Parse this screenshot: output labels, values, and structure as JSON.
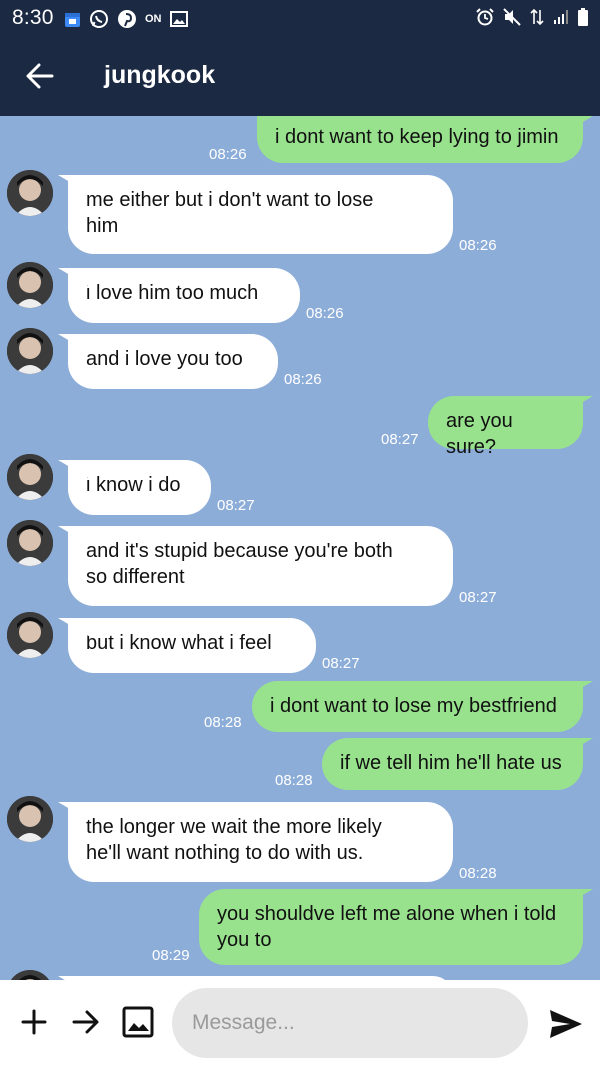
{
  "status_bar": {
    "time": "8:30",
    "icons_left": [
      "calendar-icon",
      "whatsapp-icon",
      "pinterest-icon",
      "on-icon",
      "image-icon"
    ],
    "icons_right": [
      "alarm-icon",
      "mute-icon",
      "data-icon",
      "signal-icon",
      "battery-icon"
    ],
    "on_label": "ON"
  },
  "header": {
    "title": "jungkook",
    "back_icon": "back-arrow-icon"
  },
  "messages": [
    {
      "dir": "out",
      "lines": [
        "i dont want to keep lying to jimin"
      ],
      "time": "08:26"
    },
    {
      "dir": "in",
      "lines": [
        "me either but i don't want to lose",
        "him"
      ],
      "time": "08:26"
    },
    {
      "dir": "in",
      "lines": [
        "i love him too much"
      ],
      "time": "08:26"
    },
    {
      "dir": "in",
      "lines": [
        "and i love you too"
      ],
      "time": "08:26"
    },
    {
      "dir": "out",
      "lines": [
        "are you sure?"
      ],
      "time": "08:27"
    },
    {
      "dir": "in",
      "lines": [
        "i know i do"
      ],
      "time": "08:27"
    },
    {
      "dir": "in",
      "lines": [
        "and it's stupid because you're both",
        "so different"
      ],
      "time": "08:27"
    },
    {
      "dir": "in",
      "lines": [
        "but i know what i feel"
      ],
      "time": "08:27"
    },
    {
      "dir": "out",
      "lines": [
        "i dont want to lose my bestfriend"
      ],
      "time": "08:28"
    },
    {
      "dir": "out",
      "lines": [
        "if we tell him he'll hate us"
      ],
      "time": "08:28"
    },
    {
      "dir": "in",
      "lines": [
        "the longer we wait the more likely",
        "he'll want nothing to do with us."
      ],
      "time": "08:28"
    },
    {
      "dir": "out",
      "lines": [
        "you shouldve left me alone when i told",
        "you to"
      ],
      "time": "08:29"
    }
  ],
  "input_bar": {
    "placeholder": "Message...",
    "value": "",
    "icons": [
      "plus-icon",
      "forward-arrow-icon",
      "image-icon",
      "send-icon"
    ]
  },
  "colors": {
    "header_bg": "#1c2942",
    "chat_bg": "#8dadd9",
    "incoming_bubble": "#ffffff",
    "outgoing_bubble": "#98e28d",
    "input_bg": "#e6e6e6"
  }
}
